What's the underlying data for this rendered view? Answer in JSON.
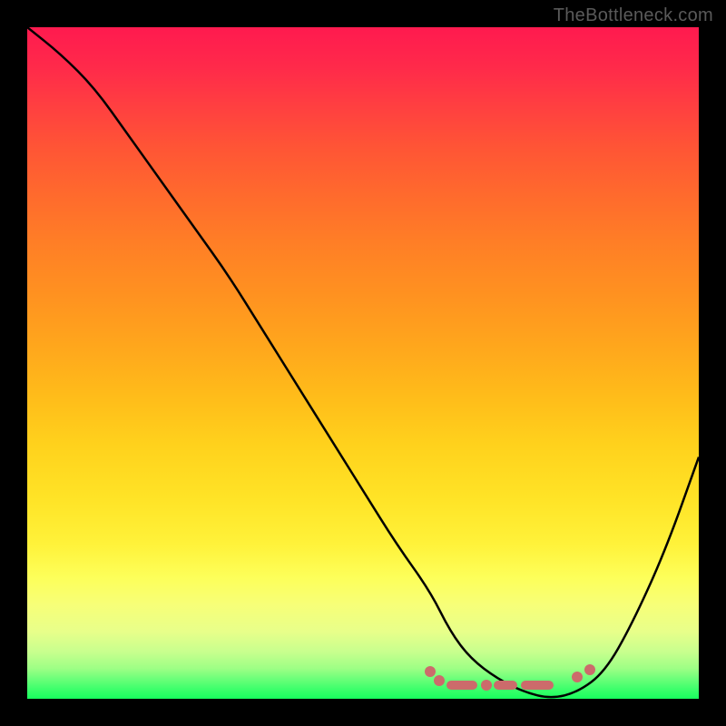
{
  "watermark": "TheBottleneck.com",
  "chart_data": {
    "type": "line",
    "title": "",
    "xlabel": "",
    "ylabel": "",
    "xlim": [
      0,
      100
    ],
    "ylim": [
      0,
      100
    ],
    "series": [
      {
        "name": "bottleneck-curve",
        "x": [
          0,
          5,
          10,
          15,
          20,
          25,
          30,
          35,
          40,
          45,
          50,
          55,
          60,
          63,
          66,
          70,
          74,
          78,
          82,
          86,
          90,
          95,
          100
        ],
        "values": [
          100,
          96,
          91,
          84,
          77,
          70,
          63,
          55,
          47,
          39,
          31,
          23,
          16,
          10,
          6,
          3,
          1,
          0,
          1,
          4,
          11,
          22,
          36
        ]
      }
    ],
    "floor_markers": {
      "description": "near-zero bottleneck range markers",
      "range_start_x": 62,
      "range_end_x": 86
    },
    "gradient": {
      "top": "#ff1a4f",
      "mid": "#ffe326",
      "bottom": "#18ff5e"
    }
  }
}
